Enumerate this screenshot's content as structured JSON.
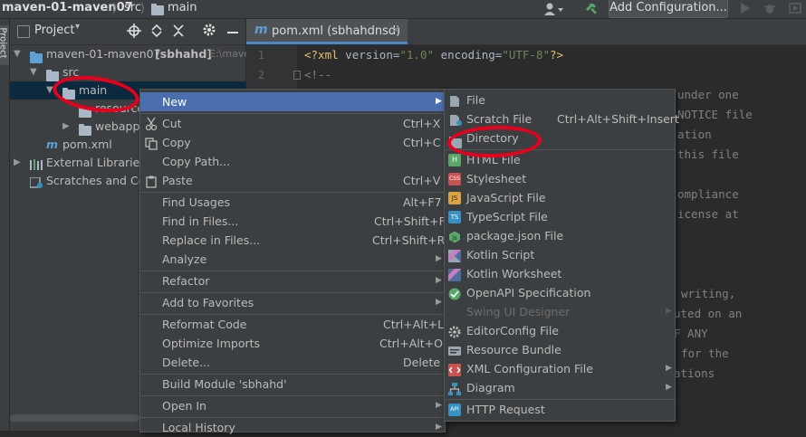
{
  "breadcrumb": {
    "project": "maven-01-maven07",
    "src": "src",
    "main": "main"
  },
  "toolbar": {
    "add_config": "Add Configuration..."
  },
  "left_strip": {
    "project_tab": "Project"
  },
  "panel": {
    "title": "Project"
  },
  "tree": {
    "root_name": "maven-01-maven07",
    "root_module": "[sbhahd]",
    "root_path": "E:\\mave",
    "src": "src",
    "main": "main",
    "resources": "resources",
    "webapp": "webapp",
    "pom": "pom.xml",
    "external": "External Libraries",
    "scratches": "Scratches and Co"
  },
  "editor": {
    "tab_title": "pom.xml (sbhahdnsd)",
    "line_numbers": [
      "1",
      "2"
    ],
    "line1_decl": "<?xml",
    "line1_attr1": "version",
    "line1_val1": "\"1.0\"",
    "line1_attr2": "encoding",
    "line1_val2": "\"UTF-8\"",
    "line1_end": "?>",
    "line2": "<!--",
    "fragments": [
      "under one",
      "NOTICE file",
      "ation",
      "this file",
      "ompliance",
      "icense at",
      "writing,",
      "uted on an",
      "F ANY",
      "for the",
      "ations"
    ]
  },
  "context_menu": {
    "items": [
      {
        "label": "New",
        "shortcut": "",
        "submenu": true
      },
      {
        "label": "Cut",
        "shortcut": "Ctrl+X"
      },
      {
        "label": "Copy",
        "shortcut": "Ctrl+C"
      },
      {
        "label": "Copy Path...",
        "shortcut": ""
      },
      {
        "label": "Paste",
        "shortcut": "Ctrl+V"
      },
      {
        "label": "Find Usages",
        "shortcut": "Alt+F7"
      },
      {
        "label": "Find in Files...",
        "shortcut": "Ctrl+Shift+F"
      },
      {
        "label": "Replace in Files...",
        "shortcut": "Ctrl+Shift+R"
      },
      {
        "label": "Analyze",
        "shortcut": "",
        "submenu": true
      },
      {
        "label": "Refactor",
        "shortcut": "",
        "submenu": true
      },
      {
        "label": "Add to Favorites",
        "shortcut": "",
        "submenu": true
      },
      {
        "label": "Reformat Code",
        "shortcut": "Ctrl+Alt+L"
      },
      {
        "label": "Optimize Imports",
        "shortcut": "Ctrl+Alt+O"
      },
      {
        "label": "Delete...",
        "shortcut": "Delete"
      },
      {
        "label": "Build Module 'sbhahd'",
        "shortcut": ""
      },
      {
        "label": "Open In",
        "shortcut": "",
        "submenu": true
      },
      {
        "label": "Local History",
        "shortcut": "",
        "submenu": true
      }
    ]
  },
  "new_submenu": {
    "items": [
      {
        "label": "File",
        "shortcut": ""
      },
      {
        "label": "Scratch File",
        "shortcut": "Ctrl+Alt+Shift+Insert"
      },
      {
        "label": "Directory",
        "shortcut": ""
      },
      {
        "label": "HTML File",
        "shortcut": ""
      },
      {
        "label": "Stylesheet",
        "shortcut": ""
      },
      {
        "label": "JavaScript File",
        "shortcut": ""
      },
      {
        "label": "TypeScript File",
        "shortcut": ""
      },
      {
        "label": "package.json File",
        "shortcut": ""
      },
      {
        "label": "Kotlin Script",
        "shortcut": ""
      },
      {
        "label": "Kotlin Worksheet",
        "shortcut": ""
      },
      {
        "label": "OpenAPI Specification",
        "shortcut": ""
      },
      {
        "label": "Swing UI Designer",
        "shortcut": "",
        "disabled": true
      },
      {
        "label": "EditorConfig File",
        "shortcut": ""
      },
      {
        "label": "Resource Bundle",
        "shortcut": ""
      },
      {
        "label": "XML Configuration File",
        "shortcut": "",
        "submenu": true
      },
      {
        "label": "Diagram",
        "shortcut": "",
        "submenu": true
      },
      {
        "label": "HTTP Request",
        "shortcut": ""
      }
    ]
  },
  "icon_badges": {
    "html": "H",
    "css": "CSS",
    "js": "JS",
    "ts": "TS",
    "api": "API"
  },
  "colors": {
    "accent": "#4b6eaf",
    "annotation": "#e8001c",
    "background": "#2b2b2b",
    "panel": "#3c3f41"
  }
}
